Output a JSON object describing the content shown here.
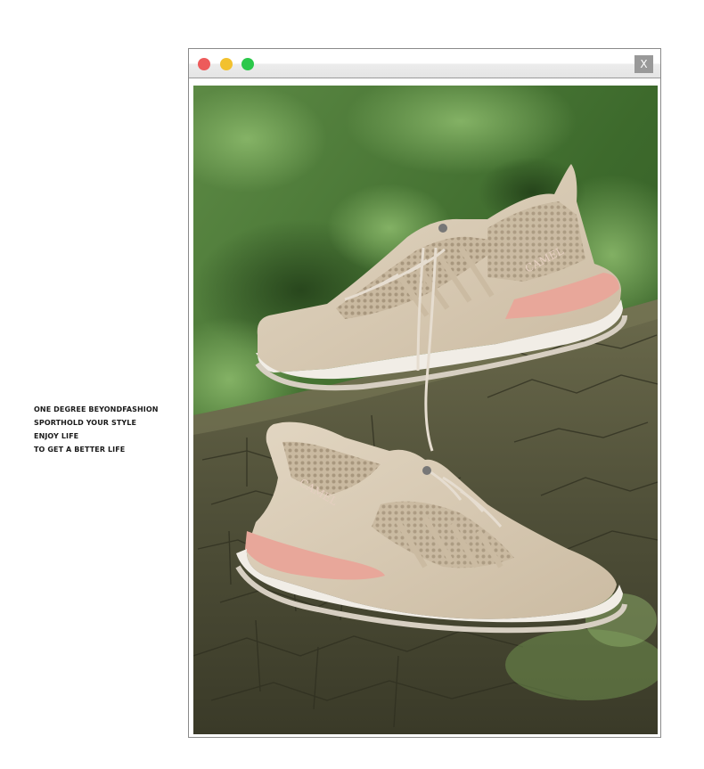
{
  "tagline": {
    "lines": [
      "ONE DEGREE BEYONDFASHION",
      "SPORTHOLD YOUR STYLE",
      "ENJOY LIFE",
      "TO GET A BETTER LIFE"
    ]
  },
  "window": {
    "buttons": {
      "close_color": "#ed5b5b",
      "minimize_color": "#f2c12e",
      "maximize_color": "#2bc84a"
    },
    "close_label": "X"
  },
  "photo": {
    "subject": "shoe-product-photo",
    "brand_mark": "CAMEL",
    "colors": {
      "foliage": "#3f6a2e",
      "bark": "#55573f",
      "shoe_upper": "#d8cbb6",
      "shoe_accent": "#e8a79a",
      "sole": "#f1ede6"
    }
  }
}
